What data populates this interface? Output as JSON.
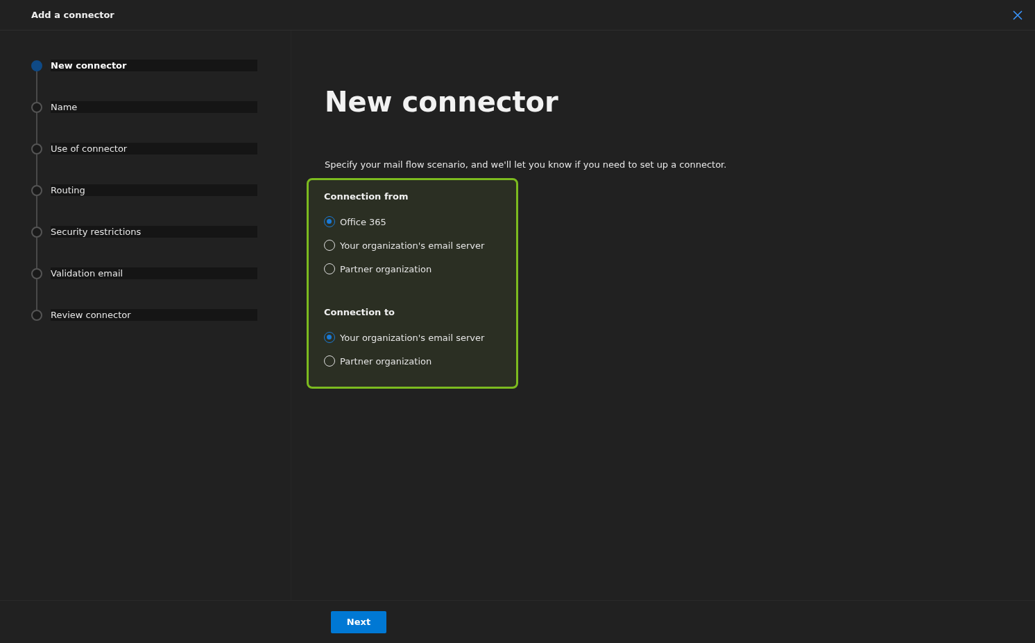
{
  "window": {
    "title": "Add a connector"
  },
  "steps": [
    {
      "label": "New connector",
      "selected": true
    },
    {
      "label": "Name",
      "selected": false
    },
    {
      "label": "Use of connector",
      "selected": false
    },
    {
      "label": "Routing",
      "selected": false
    },
    {
      "label": "Security restrictions",
      "selected": false
    },
    {
      "label": "Validation email",
      "selected": false
    },
    {
      "label": "Review connector",
      "selected": false
    }
  ],
  "page": {
    "heading": "New connector",
    "description": "Specify your mail flow scenario, and we'll let you know if you need to set up a connector.",
    "groups": [
      {
        "label": "Connection from",
        "options": [
          {
            "label": "Office 365",
            "selected": true
          },
          {
            "label": "Your organization's email server",
            "selected": false
          },
          {
            "label": "Partner organization",
            "selected": false
          }
        ]
      },
      {
        "label": "Connection to",
        "options": [
          {
            "label": "Your organization's email server",
            "selected": true
          },
          {
            "label": "Partner organization",
            "selected": false
          }
        ]
      }
    ]
  },
  "footer": {
    "next_button": "Next"
  }
}
